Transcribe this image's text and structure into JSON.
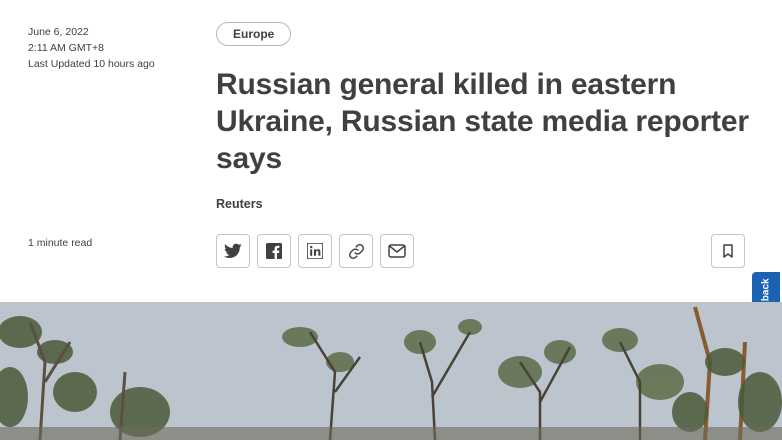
{
  "article": {
    "date": "June 6, 2022",
    "time": "2:11 AM GMT+8",
    "last_updated": "Last Updated 10 hours ago",
    "read_time": "1 minute read",
    "section_tag": "Europe",
    "headline": "Russian general killed in eastern Ukraine, Russian state media reporter says",
    "byline": "Reuters"
  },
  "share": {
    "icons": [
      "twitter-icon",
      "facebook-icon",
      "linkedin-icon",
      "link-icon",
      "email-icon"
    ]
  },
  "bookmark": {
    "icon": "bookmark-icon"
  },
  "feedback": {
    "label": "Feedback"
  },
  "colors": {
    "text": "#404040",
    "feedback_bg": "#1b62b5",
    "border": "#c4c4c4"
  }
}
